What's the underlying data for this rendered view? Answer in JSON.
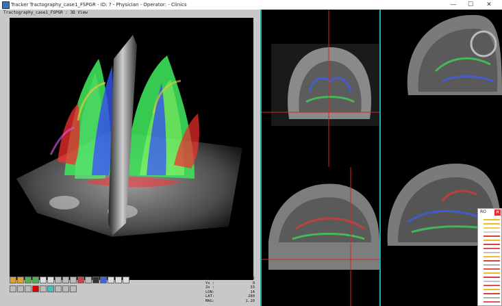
{
  "window": {
    "title": "Tracker Tractography_case1_FSPGR - ID: ? - Physician - Operator: - Clinics",
    "minimize_glyph": "—",
    "maximize_glyph": "☐",
    "close_glyph": "✕"
  },
  "view3d": {
    "label": "Tractography_case1_FSPGR : 3D View"
  },
  "coords": [
    {
      "label": "Xo :",
      "value": "-2"
    },
    {
      "label": "Yo :",
      "value": "9"
    },
    {
      "label": "Zo :",
      "value": "33"
    },
    {
      "label": "LON:",
      "value": "14"
    },
    {
      "label": "LAT:",
      "value": "280"
    },
    {
      "label": "MAG:",
      "value": "1.20"
    }
  ],
  "legend": {
    "title": "RO",
    "close_glyph": "✕"
  },
  "icons": {
    "app": "app-icon",
    "close": "close-icon"
  },
  "colors": {
    "divider": "#2aa7a7",
    "crosshair": "#e02020",
    "tract_green": "#3ee05a",
    "tract_blue": "#3a5cff",
    "tract_red": "#ff3030"
  }
}
